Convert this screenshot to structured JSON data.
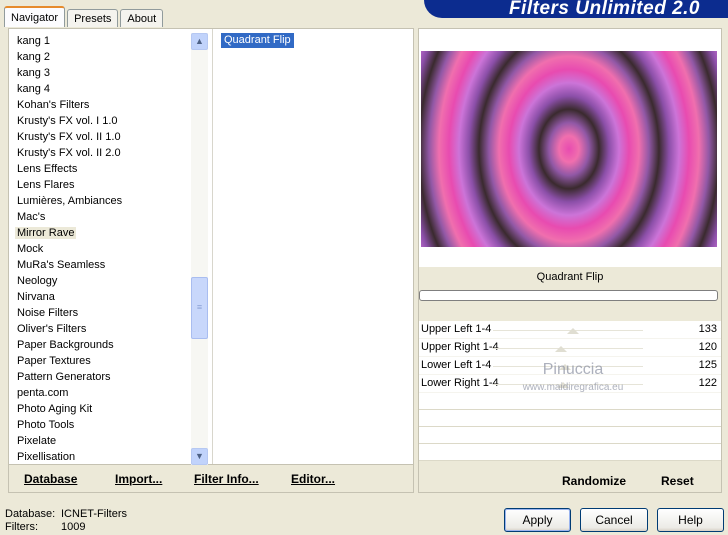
{
  "tabs": [
    {
      "label": "Navigator",
      "active": true
    },
    {
      "label": "Presets",
      "active": false
    },
    {
      "label": "About",
      "active": false
    }
  ],
  "banner": {
    "title": "Filters Unlimited 2.0"
  },
  "categories": [
    "kang 1",
    "kang 2",
    "kang 3",
    "kang 4",
    "Kohan's Filters",
    "Krusty's FX vol. I 1.0",
    "Krusty's FX vol. II 1.0",
    "Krusty's FX vol. II 2.0",
    "Lens Effects",
    "Lens Flares",
    "Lumières, Ambiances",
    "Mac's",
    "Mirror Rave",
    "Mock",
    "MuRa's Seamless",
    "Neology",
    "Nirvana",
    "Noise Filters",
    "Oliver's Filters",
    "Paper Backgrounds",
    "Paper Textures",
    "Pattern Generators",
    "penta.com",
    "Photo Aging Kit",
    "Photo Tools",
    "Pixelate",
    "Pixellisation"
  ],
  "selected_category": "Mirror Rave",
  "filters": [
    "Quadrant Flip"
  ],
  "left_buttons": {
    "database": "Database",
    "import": "Import...",
    "filter_info": "Filter Info...",
    "editor": "Editor..."
  },
  "preview": {
    "filter_name": "Quadrant Flip"
  },
  "params": [
    {
      "label": "Upper Left 1-4",
      "value": "133"
    },
    {
      "label": "Upper Right 1-4",
      "value": "120"
    },
    {
      "label": "Lower Left 1-4",
      "value": "125"
    },
    {
      "label": "Lower Right 1-4",
      "value": "122"
    }
  ],
  "watermark": {
    "name": "Pinuccia",
    "url": "www.maidiregrafica.eu"
  },
  "right_buttons": {
    "randomize": "Randomize",
    "reset": "Reset"
  },
  "status": {
    "database_label": "Database:",
    "database_value": "ICNET-Filters",
    "filters_label": "Filters:",
    "filters_value": "1009"
  },
  "dialog_buttons": {
    "apply": "Apply",
    "cancel": "Cancel",
    "help": "Help"
  }
}
